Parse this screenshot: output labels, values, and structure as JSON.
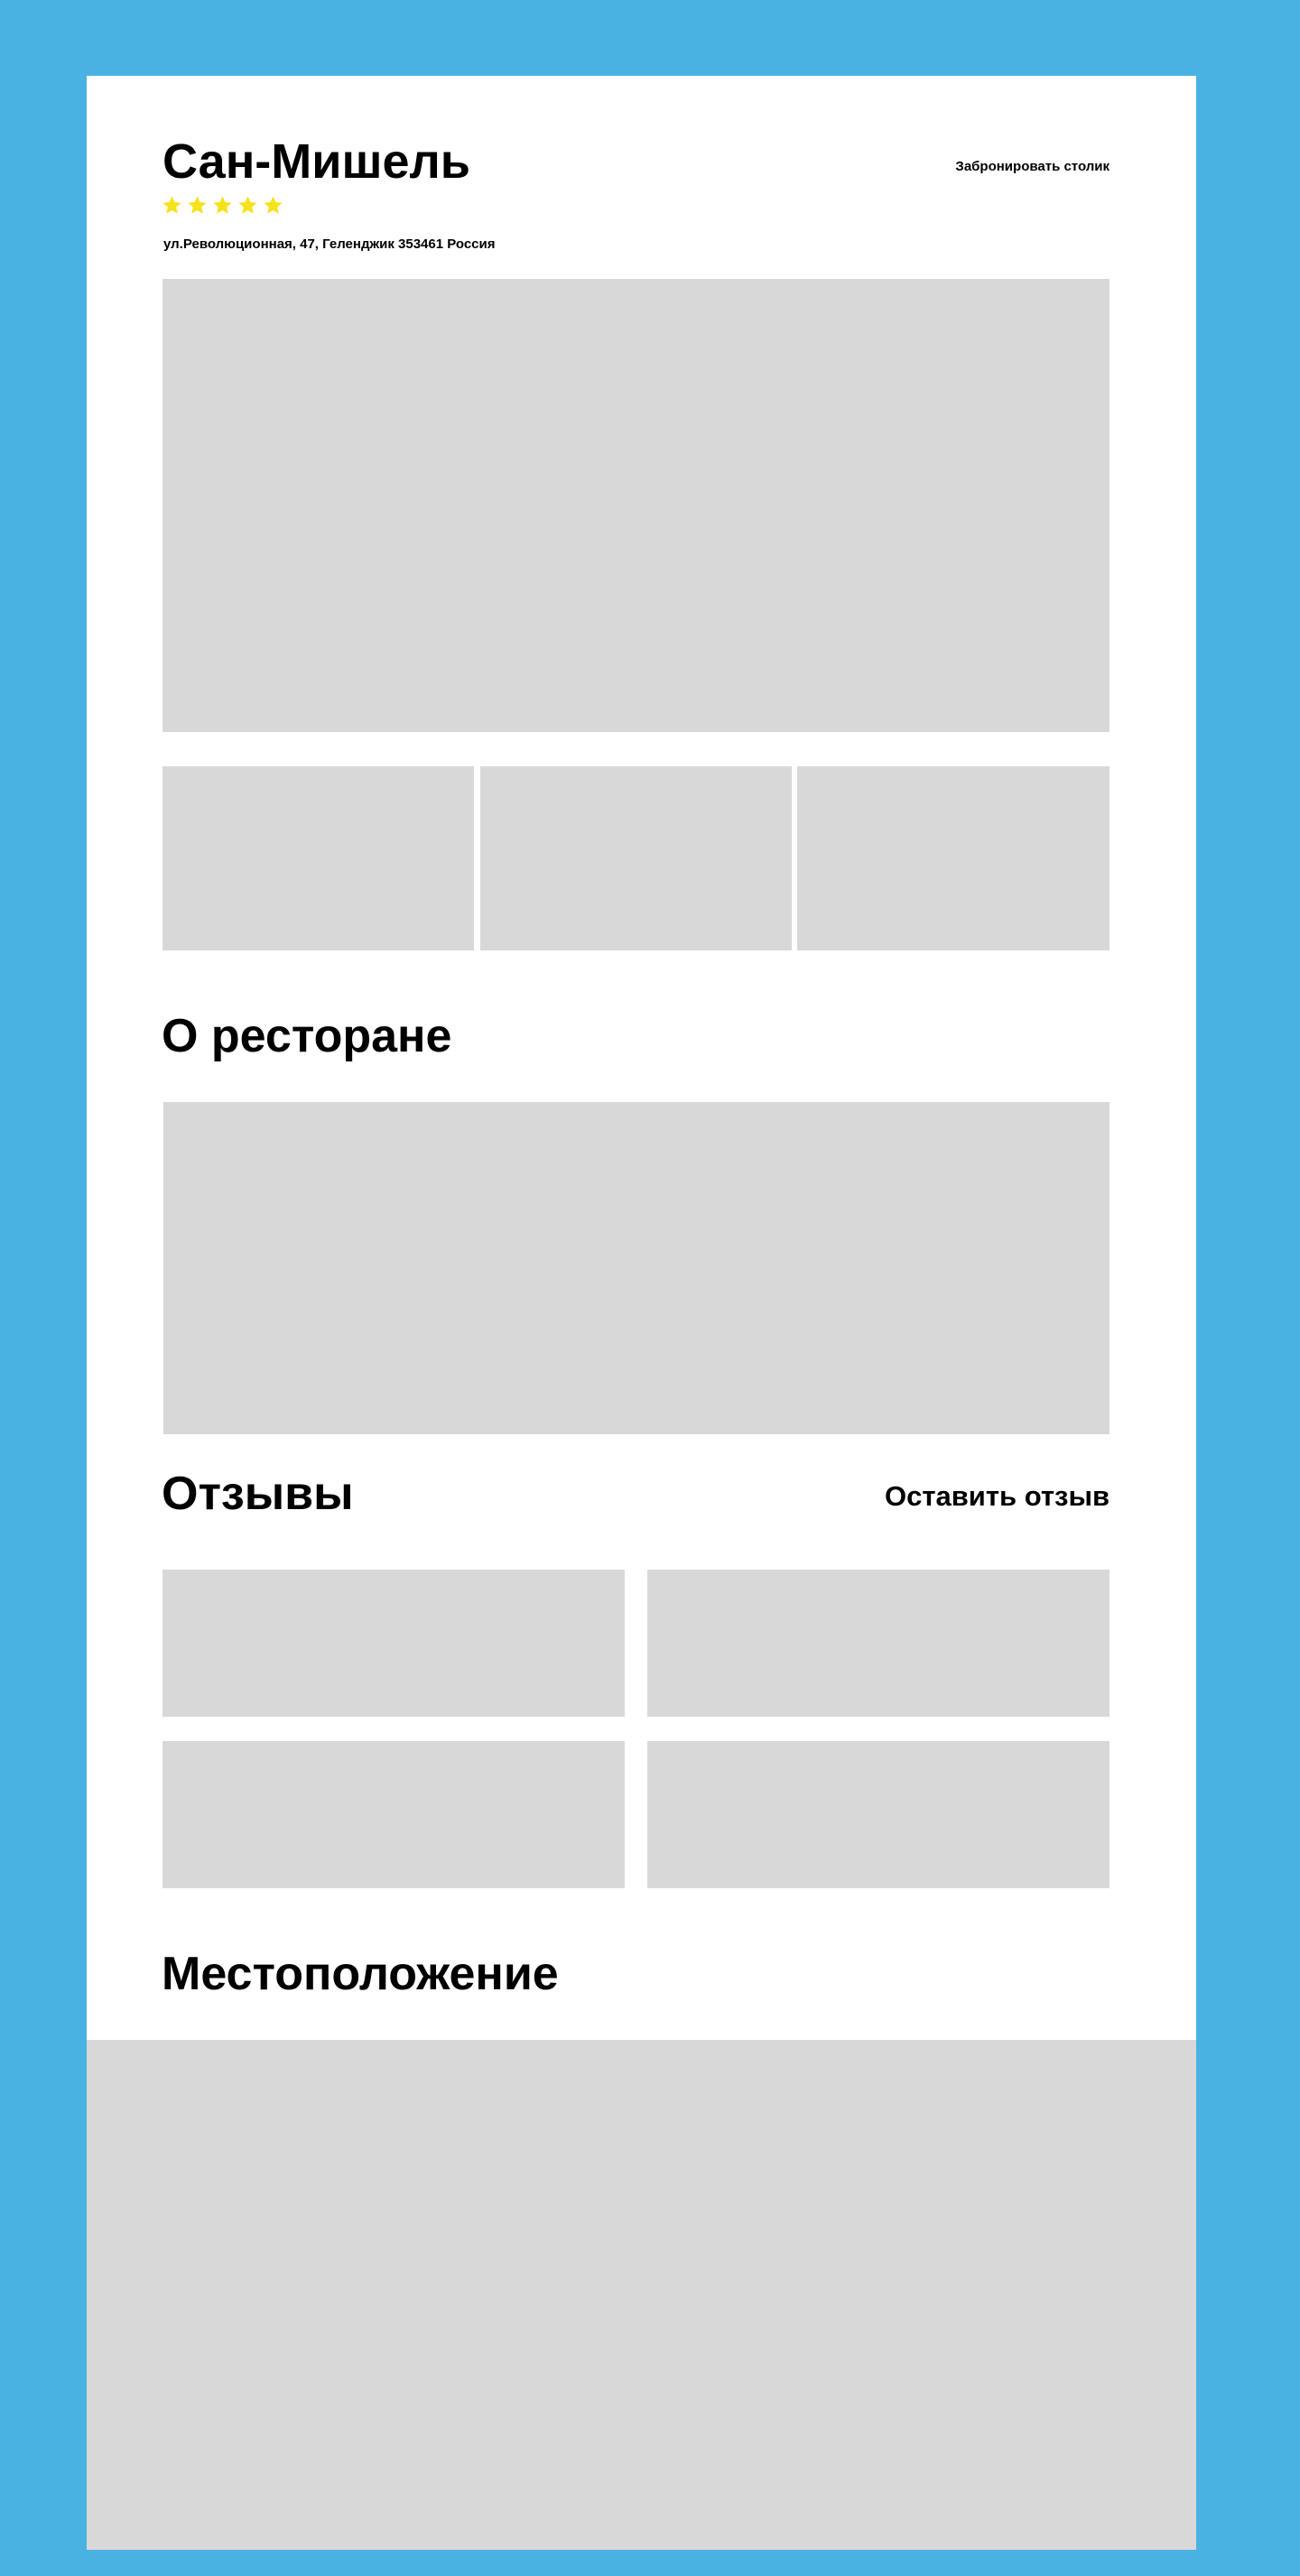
{
  "restaurant": {
    "name": "Сан-Мишель",
    "rating": 5,
    "address": "ул.Революционная, 47, Геленджик 353461 Россия",
    "book_label": "Забронировать столик"
  },
  "colors": {
    "background": "#4ab2e2",
    "page": "#ffffff",
    "placeholder": "#d8d8d8",
    "star": "#f5e21b"
  },
  "icons": {
    "star": "star-icon"
  },
  "about": {
    "title": "О ресторане"
  },
  "reviews": {
    "title": "Отзывы",
    "leave_label": "Оставить отзыв"
  },
  "location": {
    "title": "Местоположение"
  }
}
